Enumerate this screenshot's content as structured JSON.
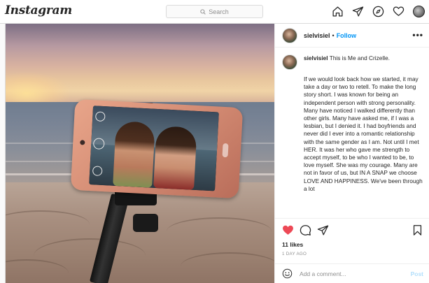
{
  "app": {
    "logo": "Instagram"
  },
  "search": {
    "placeholder": "Search"
  },
  "nav": {
    "icons": [
      "home-icon",
      "direct-message-icon",
      "explore-icon",
      "activity-heart-icon",
      "profile-avatar"
    ]
  },
  "post": {
    "username": "sielvisiel",
    "follow_label": "Follow",
    "separator": "•",
    "more_label": "•••",
    "caption": {
      "username": "sielvisiel",
      "headline": "This is Me and Crizelle.",
      "body": "If we would look back how we started, it may take a day or two to retell. To make the long story short. I was known for being an independent person with strong personality. Many have noticed I walked differently than other girls. Many have asked me, if I was a lesbian, but I denied it. I had boyfriends and never did I ever into a romantic relationship with the same gender as I am. Not until I met HER. It was her who gave me strength to accept myself, to be who I wanted to be, to love myself. She was my courage. Many are not in favor of us, but IN A SNAP we choose LOVE AND HAPPINESS. We've been through a lot"
    },
    "likes": "11 likes",
    "time": "1 DAY AGO",
    "comment": {
      "placeholder": "Add a comment...",
      "post_label": "Post"
    },
    "liked": true,
    "like_color": "#ed4956"
  },
  "colors": {
    "link_blue": "#0095f6",
    "post_disabled": "#b2dffc",
    "border": "#dbdbdb"
  }
}
